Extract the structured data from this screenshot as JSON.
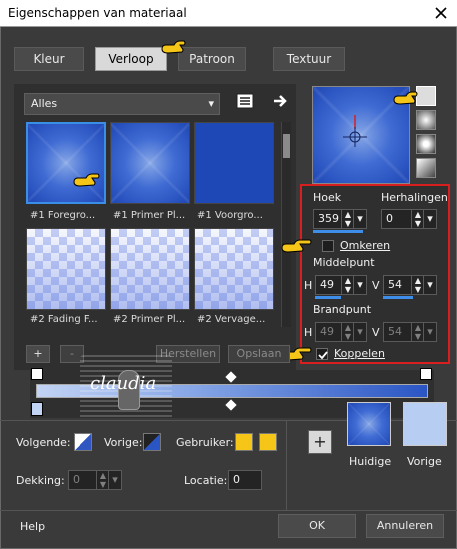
{
  "window": {
    "title": "Eigenschappen van materiaal"
  },
  "tabs": [
    {
      "label": "Kleur"
    },
    {
      "label": "Verloop"
    },
    {
      "label": "Patroon"
    },
    {
      "label": "Textuur"
    }
  ],
  "gallery": {
    "filter_value": "Alles",
    "items": [
      {
        "label": "#1 Foregro..."
      },
      {
        "label": "#1 Primer Pl..."
      },
      {
        "label": "#1 Voorgro..."
      },
      {
        "label": "#2 Fading F..."
      },
      {
        "label": "#2 Primer Pl..."
      },
      {
        "label": "#2 Vervage..."
      }
    ]
  },
  "settings": {
    "hoek_label": "Hoek",
    "hoek_value": "359",
    "herhalingen_label": "Herhalingen",
    "herhalingen_value": "0",
    "omkeren_label": "Omkeren",
    "middelpunt_label": "Middelpunt",
    "middelpunt_h_label": "H",
    "middelpunt_h_value": "49",
    "middelpunt_v_label": "V",
    "middelpunt_v_value": "54",
    "brandpunt_label": "Brandpunt",
    "brandpunt_h_label": "H",
    "brandpunt_h_value": "49",
    "brandpunt_v_label": "V",
    "brandpunt_v_value": "54",
    "koppelen_label": "Koppelen",
    "koppelen_checked": true
  },
  "editor": {
    "add_label": "+",
    "remove_label": "-",
    "reset_label": "Herstellen",
    "save_label": "Opslaan",
    "watermark_text": "claudia"
  },
  "bottom": {
    "volgende_label": "Volgende:",
    "vorige_label": "Vorige:",
    "gebruiker_label": "Gebruiker:",
    "dekking_label": "Dekking:",
    "dekking_value": "0",
    "locatie_label": "Locatie:",
    "locatie_value": "0",
    "add_swatch_label": "+",
    "huidige_label": "Huidige",
    "vorige_swatch_label": "Vorige",
    "help_label": "Help",
    "ok_label": "OK",
    "cancel_label": "Annuleren"
  },
  "colors": {
    "accent_blue": "#3e8ee9",
    "gradient_blue": "#1f48b7",
    "gradient_light": "#86a6e6",
    "user_swatch": "#f5c518",
    "vorige_swatch": "#b8cdf2",
    "highlight_red": "#d81e1e",
    "selection_border": "#3a8ee6"
  }
}
